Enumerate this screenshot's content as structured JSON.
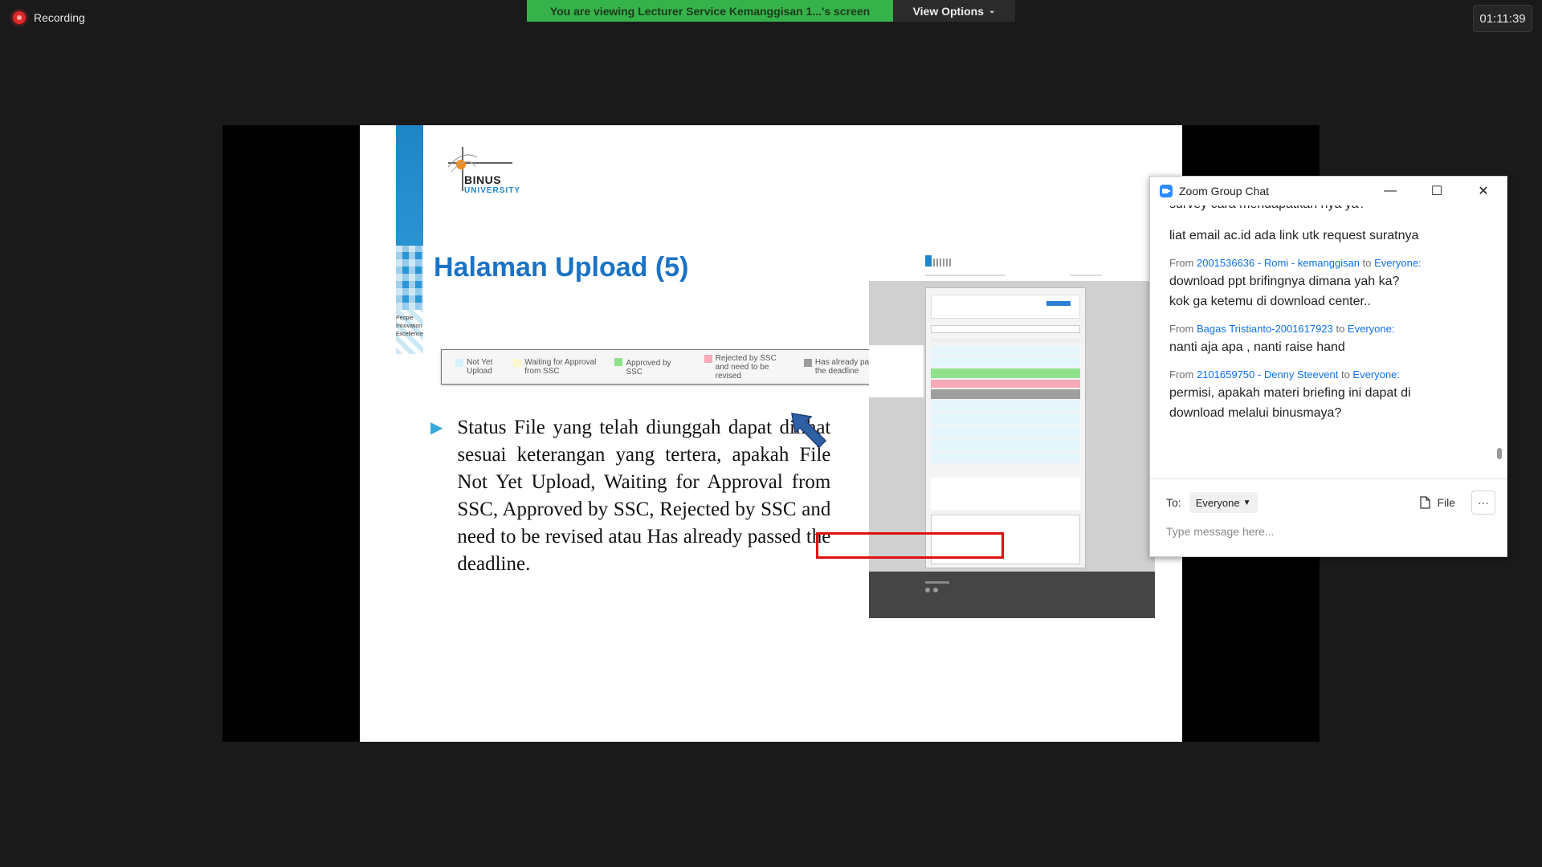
{
  "recording": {
    "label": "Recording"
  },
  "banner": {
    "viewing_text": "You are viewing Lecturer Service Kemanggisan 1...'s screen",
    "view_options_label": "View Options"
  },
  "timer": "01:11:39",
  "slide": {
    "logo_name": "BINUS",
    "logo_sub": "UNIVERSITY",
    "tagline": [
      "People",
      "Innovation",
      "Excellence"
    ],
    "title": "Halaman Upload (5)",
    "legend": [
      {
        "label": "Not Yet Upload",
        "color": "#d7f1fb"
      },
      {
        "label": "Waiting for Approval from SSC",
        "color": "#fdf7c9"
      },
      {
        "label": "Approved by SSC",
        "color": "#8fe28c"
      },
      {
        "label": "Rejected by SSC and need to be revised",
        "color": "#f6a9b6"
      },
      {
        "label": "Has already passed the deadline",
        "color": "#9e9e9e"
      }
    ],
    "bullet_text": "Status File yang telah diunggah dapat dilihat sesuai keterangan yang tertera, apakah File Not Yet Upload, Waiting for Approval from SSC, Approved by SSC, Rejected by SSC and need to be revised atau Has already passed the deadline."
  },
  "chat": {
    "title": "Zoom Group Chat",
    "partial_top": "survey cara mendapatkan nya ya?",
    "messages": [
      {
        "from": "",
        "to": "",
        "lines": [
          "liat email ac.id ada link utk request suratnya"
        ]
      },
      {
        "from": "2001536636 - Romi - kemanggisan",
        "to": "Everyone:",
        "lines": [
          "download ppt brifingnya dimana yah ka?",
          "kok ga ketemu di download center.."
        ]
      },
      {
        "from": "Bagas Tristianto-2001617923",
        "to": "Everyone:",
        "lines": [
          "nanti aja apa , nanti raise hand"
        ]
      },
      {
        "from": "2101659750 - Denny Steevent",
        "to": "Everyone:",
        "lines": [
          "permisi, apakah materi briefing ini dapat di",
          "download melalui binusmaya?"
        ]
      }
    ],
    "from_word": "From",
    "to_word": "to",
    "to_label": "To:",
    "recipient": "Everyone",
    "file_label": "File",
    "more_label": "···",
    "input_placeholder": "Type message here..."
  }
}
